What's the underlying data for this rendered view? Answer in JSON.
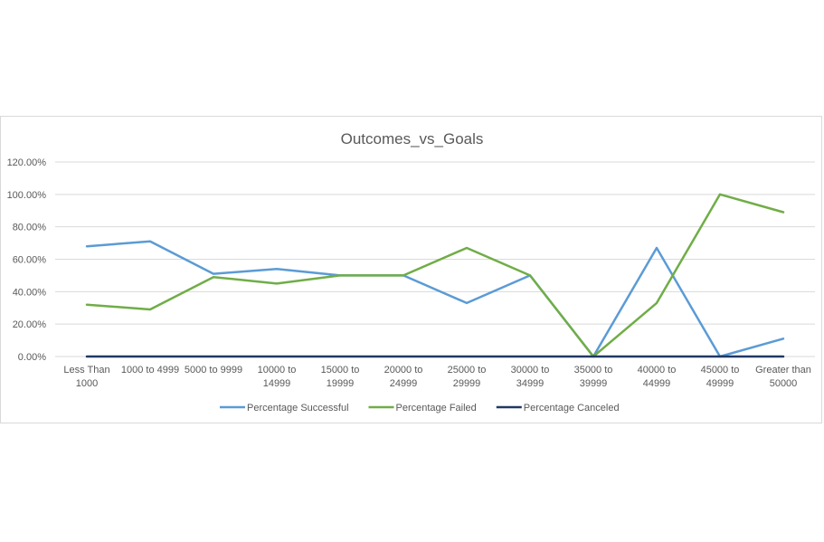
{
  "chart_data": {
    "type": "line",
    "title": "Outcomes_vs_Goals",
    "xlabel": "",
    "ylabel": "",
    "categories": [
      [
        "Less Than",
        "1000"
      ],
      [
        "1000 to 4999"
      ],
      [
        "5000 to 9999"
      ],
      [
        "10000 to",
        "14999"
      ],
      [
        "15000 to",
        "19999"
      ],
      [
        "20000 to",
        "24999"
      ],
      [
        "25000 to",
        "29999"
      ],
      [
        "30000 to",
        "34999"
      ],
      [
        "35000 to",
        "39999"
      ],
      [
        "40000 to",
        "44999"
      ],
      [
        "45000 to",
        "49999"
      ],
      [
        "Greater than",
        "50000"
      ]
    ],
    "ylim": [
      0,
      1.2
    ],
    "yticks": [
      "0.00%",
      "20.00%",
      "40.00%",
      "60.00%",
      "80.00%",
      "100.00%",
      "120.00%"
    ],
    "grid": true,
    "legend_position": "bottom",
    "series": [
      {
        "name": "Percentage Successful",
        "color": "#5b9bd5",
        "values": [
          0.68,
          0.71,
          0.51,
          0.54,
          0.5,
          0.5,
          0.33,
          0.5,
          0.0,
          0.67,
          0.0,
          0.11
        ]
      },
      {
        "name": "Percentage Failed",
        "color": "#70ad47",
        "values": [
          0.32,
          0.29,
          0.49,
          0.45,
          0.5,
          0.5,
          0.67,
          0.5,
          0.0,
          0.33,
          1.0,
          0.89
        ]
      },
      {
        "name": "Percentage Canceled",
        "color": "#203864",
        "values": [
          0,
          0,
          0,
          0,
          0,
          0,
          0,
          0,
          0,
          0,
          0,
          0
        ]
      }
    ]
  }
}
